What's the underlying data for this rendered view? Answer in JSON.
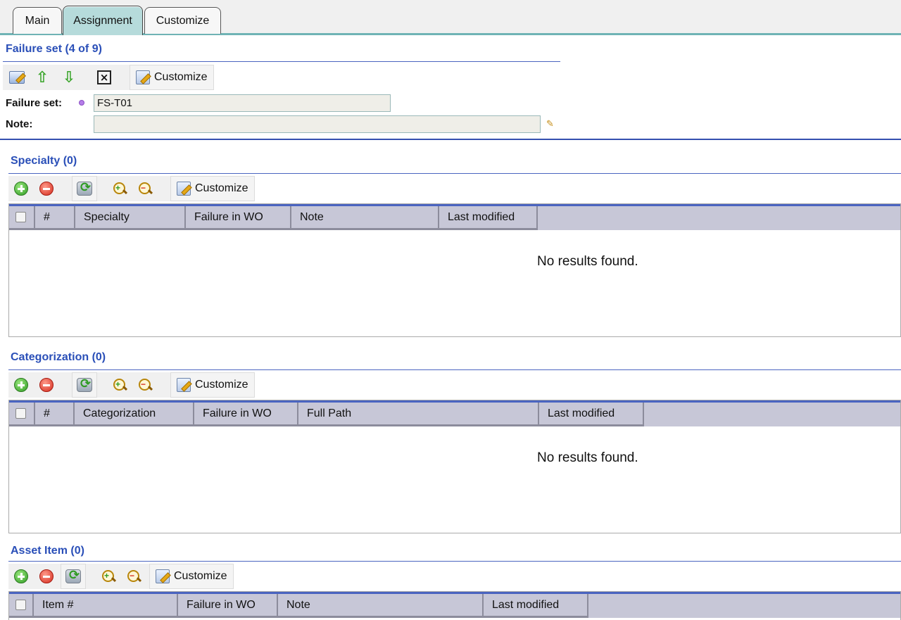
{
  "tabs": [
    {
      "label": "Main"
    },
    {
      "label": "Assignment"
    },
    {
      "label": "Customize"
    }
  ],
  "failure_set_section": {
    "title": "Failure set (4 of 9)",
    "toolbar": {
      "customize_label": "Customize"
    },
    "fields": {
      "failure_set_label": "Failure set:",
      "failure_set_value": "FS-T01",
      "note_label": "Note:",
      "note_value": ""
    }
  },
  "specialty_section": {
    "title": "Specialty (0)",
    "customize_label": "Customize",
    "columns": [
      "#",
      "Specialty",
      "Failure in WO",
      "Note",
      "Last modified"
    ],
    "empty_message": "No results found."
  },
  "categorization_section": {
    "title": "Categorization (0)",
    "customize_label": "Customize",
    "columns": [
      "#",
      "Categorization",
      "Failure in WO",
      "Full Path",
      "Last modified"
    ],
    "empty_message": "No results found."
  },
  "asset_item_section": {
    "title": "Asset Item (0)",
    "customize_label": "Customize",
    "columns": [
      "Item #",
      "Failure in WO",
      "Note",
      "Last modified"
    ]
  },
  "colors": {
    "accent_blue": "#2a4fb8",
    "active_tab": "#b6dbdb",
    "grid_header": "#c7c7d7"
  }
}
